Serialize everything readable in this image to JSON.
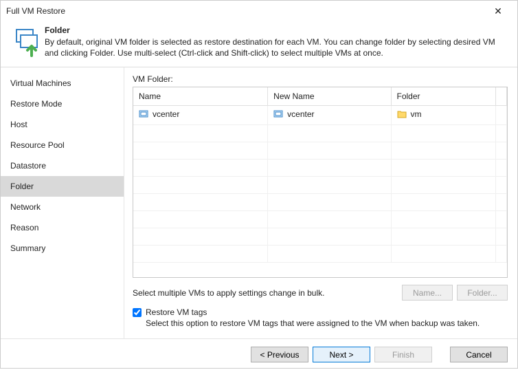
{
  "window": {
    "title": "Full VM Restore",
    "close": "✕"
  },
  "header": {
    "heading": "Folder",
    "desc": "By default, original VM folder is selected as restore destination for each VM. You can change folder by selecting desired VM and clicking Folder. Use multi-select (Ctrl-click and Shift-click) to select multiple VMs at once."
  },
  "sidebar": {
    "items": [
      "Virtual Machines",
      "Restore Mode",
      "Host",
      "Resource Pool",
      "Datastore",
      "Folder",
      "Network",
      "Reason",
      "Summary"
    ],
    "active_index": 5
  },
  "content": {
    "field_label": "VM Folder:",
    "columns": [
      "Name",
      "New Name",
      "Folder"
    ],
    "rows": [
      {
        "name": "vcenter",
        "new_name": "vcenter",
        "folder": "vm"
      }
    ],
    "bulk_hint": "Select multiple VMs to apply settings change in bulk.",
    "name_btn": "Name...",
    "folder_btn": "Folder...",
    "restore_tags_label": "Restore VM tags",
    "restore_tags_checked": true,
    "restore_tags_desc": "Select this option to restore VM tags that were assigned to the VM when backup was taken."
  },
  "footer": {
    "previous": "< Previous",
    "next": "Next >",
    "finish": "Finish",
    "cancel": "Cancel"
  }
}
